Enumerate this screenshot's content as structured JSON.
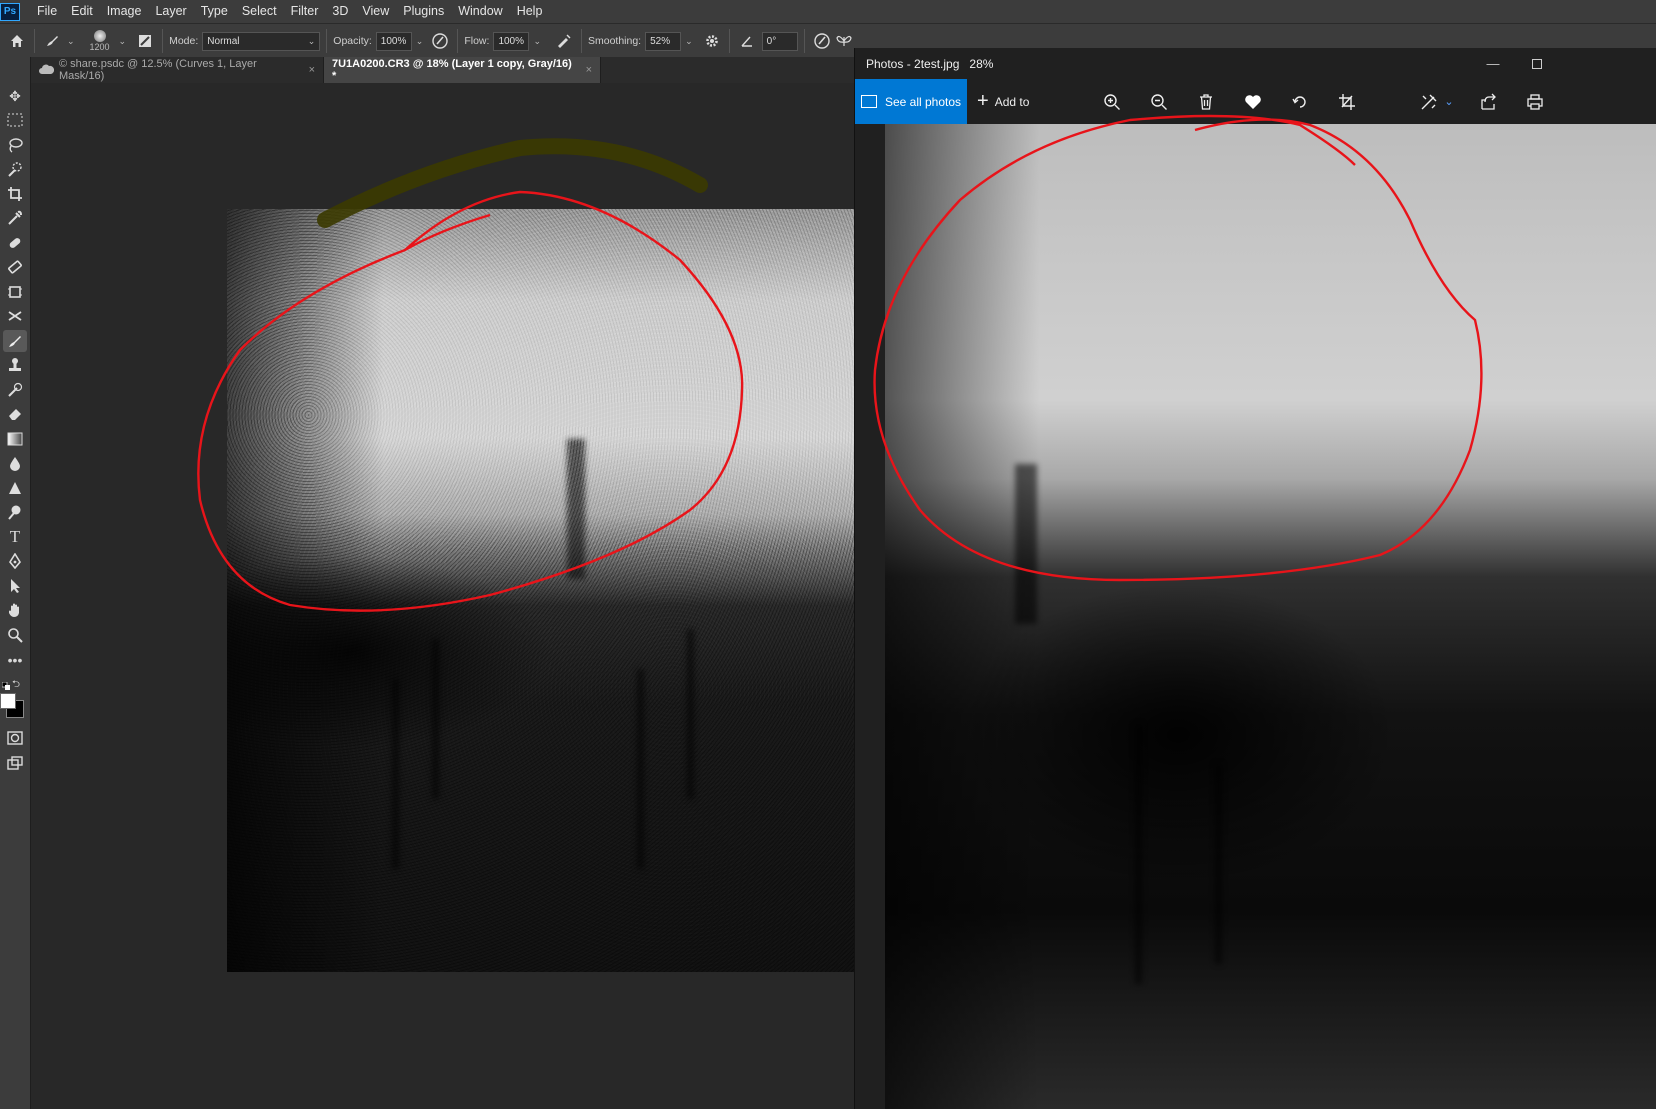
{
  "photoshop": {
    "app_icon": "Ps",
    "menu": [
      "File",
      "Edit",
      "Image",
      "Layer",
      "Type",
      "Select",
      "Filter",
      "3D",
      "View",
      "Plugins",
      "Window",
      "Help"
    ],
    "options": {
      "brush_size": "1200",
      "mode_label": "Mode:",
      "mode_value": "Normal",
      "opacity_label": "Opacity:",
      "opacity_value": "100%",
      "flow_label": "Flow:",
      "flow_value": "100%",
      "smoothing_label": "Smoothing:",
      "smoothing_value": "52%",
      "angle_value": "0°"
    },
    "tabs": [
      {
        "label": "© share.psdc @ 12.5% (Curves 1, Layer Mask/16)",
        "close": "×",
        "active": false
      },
      {
        "label": "7U1A0200.CR3 @ 18% (Layer 1 copy, Gray/16) *",
        "close": "×",
        "active": true
      }
    ],
    "tools": [
      "move-icon",
      "marquee-icon",
      "lasso-icon",
      "quick-select-icon",
      "crop-icon",
      "eyedropper-icon",
      "healing-icon",
      "patch-icon",
      "frame-icon",
      "content-aware-icon",
      "brush-icon",
      "stamp-icon",
      "history-brush-icon",
      "eraser-icon",
      "gradient-icon",
      "blur-icon",
      "sharpen-icon",
      "dodge-icon",
      "type-icon",
      "pen-icon",
      "path-select-icon",
      "hand-icon",
      "zoom-icon",
      "more-icon"
    ]
  },
  "photos": {
    "title": "Photos - 2test.jpg",
    "zoom": "28%",
    "see_all_label": "See all photos",
    "add_to_label": "Add to",
    "toolbar_icons": [
      "zoom-in-icon",
      "zoom-out-icon",
      "delete-icon",
      "heart-icon",
      "rotate-icon",
      "crop-icon",
      "edit-icon",
      "share-icon",
      "print-icon"
    ]
  },
  "colors": {
    "accent": "#0078d4",
    "annotation": "#e8141a",
    "ps_panel": "#3c3c3c"
  }
}
